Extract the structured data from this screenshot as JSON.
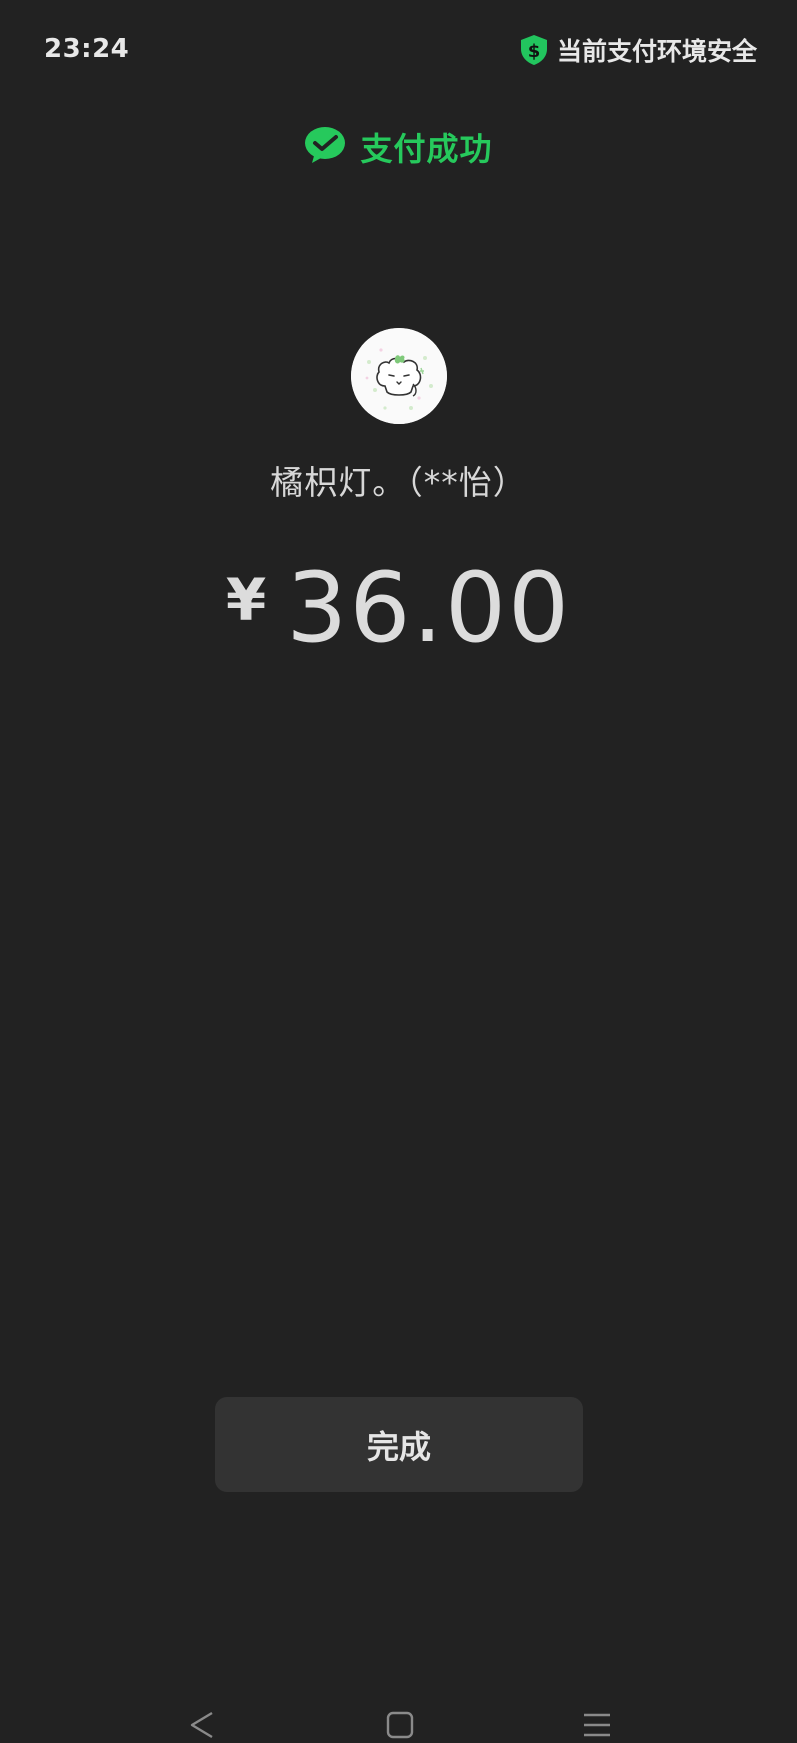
{
  "status_bar": {
    "time": "23:24",
    "security_text": "当前支付环境安全",
    "security_icon": "shield-dollar-icon",
    "security_color": "#22c55e"
  },
  "result": {
    "title": "支付成功",
    "icon": "wechat-pay-icon",
    "accent_color": "#26c95c"
  },
  "payee": {
    "name": "橘枳灯。（**怡）",
    "avatar": "payee-avatar"
  },
  "amount": {
    "currency_symbol": "¥",
    "value": "36.00"
  },
  "actions": {
    "done_label": "完成"
  },
  "nav_bar": {
    "back_icon": "back-triangle-icon",
    "home_icon": "home-square-icon",
    "menu_icon": "menu-lines-icon"
  },
  "colors": {
    "background": "#222222",
    "button_background": "#333333"
  }
}
